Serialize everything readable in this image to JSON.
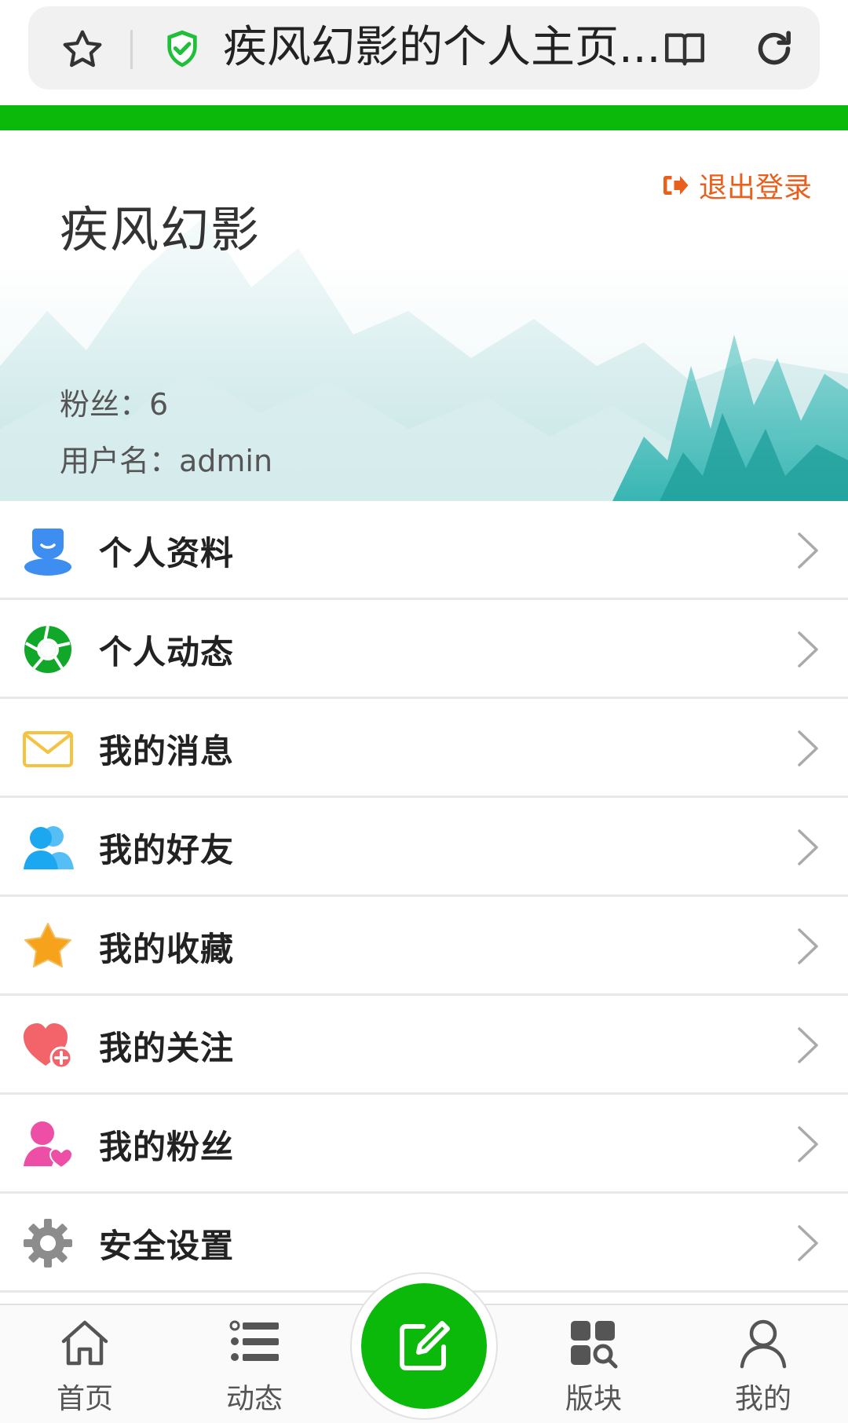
{
  "browser": {
    "page_title": "疾风幻影的个人主页...",
    "bookmark_icon": "star-outline-icon",
    "secure_icon": "shield-check-icon",
    "reader_icon": "reader-mode-icon",
    "reload_icon": "reload-icon",
    "progress_color": "#0bb90b"
  },
  "profile": {
    "display_name": "疾风幻影",
    "logout_label": "退出登录",
    "logout_icon": "sign-out-icon",
    "fans_text": "粉丝：6",
    "username_text": "用户名：admin"
  },
  "menu": [
    {
      "label": "个人资料",
      "icon": "user-profile-icon",
      "color": "#3d8ef0"
    },
    {
      "label": "个人动态",
      "icon": "aperture-icon",
      "color": "#11a82a"
    },
    {
      "label": "我的消息",
      "icon": "envelope-icon",
      "color": "#f5c242"
    },
    {
      "label": "我的好友",
      "icon": "friends-icon",
      "color": "#1ca8f0"
    },
    {
      "label": "我的收藏",
      "icon": "star-icon",
      "color": "#f7a21b"
    },
    {
      "label": "我的关注",
      "icon": "heart-plus-icon",
      "color": "#f2646a"
    },
    {
      "label": "我的粉丝",
      "icon": "fan-user-icon",
      "color": "#ee4fa6"
    },
    {
      "label": "安全设置",
      "icon": "gear-icon",
      "color": "#8c8c8c"
    }
  ],
  "tabbar": {
    "home_label": "首页",
    "feed_label": "动态",
    "board_label": "版块",
    "mine_label": "我的",
    "post_icon": "edit-icon",
    "post_color": "#0bb90b"
  }
}
